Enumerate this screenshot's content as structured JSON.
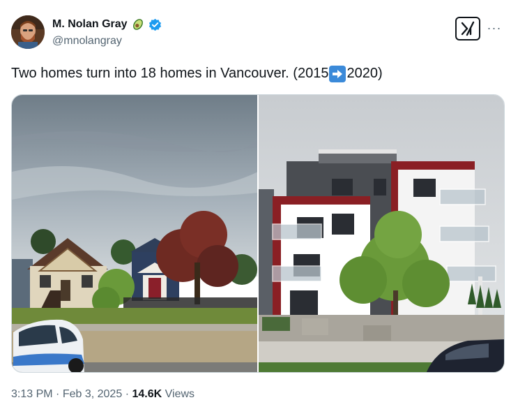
{
  "author": {
    "display_name": "M. Nolan Gray",
    "handle": "@mnolangray",
    "name_emoji": "avocado-emoji",
    "verified": true
  },
  "tweet": {
    "text_before_arrow": "Two homes turn into 18 homes in Vancouver. (2015",
    "arrow_emoji": "right-arrow-emoji",
    "text_after_arrow": "2020)"
  },
  "media": {
    "images": [
      {
        "name": "vancouver-2015-photo",
        "subject": "two older detached houses"
      },
      {
        "name": "vancouver-2020-photo",
        "subject": "new four-storey apartment building"
      }
    ]
  },
  "meta": {
    "time": "3:13 PM",
    "date": "Feb 3, 2025",
    "separator": "·",
    "views_count": "14.6K",
    "views_label": "Views"
  },
  "colors": {
    "text_primary": "#0f1419",
    "text_secondary": "#536471",
    "verified_blue": "#1d9bf0",
    "border": "#cfd9de"
  },
  "icons": [
    "x-grok-icon",
    "more-icon",
    "verified-icon"
  ]
}
